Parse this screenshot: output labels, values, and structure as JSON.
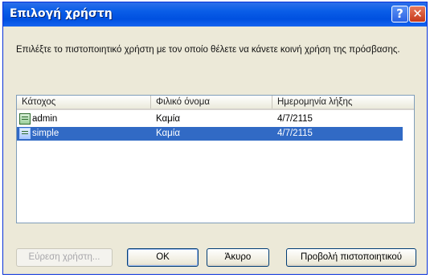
{
  "window": {
    "title": "Επιλογή χρήστη",
    "help_glyph": "?",
    "close_glyph": "✕"
  },
  "prompt": "Επιλέξτε το πιστοποιητικό χρήστη με τον οποίο θέλετε να κάνετε κοινή χρήση της πρόσβασης.",
  "list": {
    "columns": [
      "Κάτοχος",
      "Φιλικό όνομα",
      "Ημερομηνία λήξης"
    ],
    "rows": [
      {
        "owner": "admin",
        "friendly_name": "Καμία",
        "expires": "4/7/2115",
        "selected": false
      },
      {
        "owner": "simple",
        "friendly_name": "Καμία",
        "expires": "4/7/2115",
        "selected": true
      }
    ]
  },
  "buttons": {
    "find_user": "Εύρεση χρήστη...",
    "ok": "OK",
    "cancel": "Άκυρο",
    "view_certificate": "Προβολή πιστοποιητικού"
  },
  "colors": {
    "title_bar": "#0a5ee8",
    "selection": "#316ac5",
    "dialog_bg": "#ece9d8"
  },
  "icons": [
    "help-icon",
    "close-icon",
    "certificate-icon"
  ]
}
